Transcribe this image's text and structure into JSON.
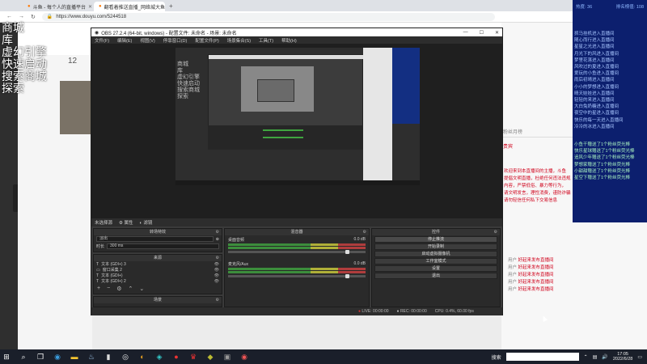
{
  "browser": {
    "tabs": [
      {
        "label": "斗鱼 - 每个人的直播平台",
        "active": false
      },
      {
        "label": "翻看着推送直播_网络城大鱼斗鱼",
        "active": true
      }
    ],
    "new_tab": "+",
    "win_min": "—",
    "win_max": "☐",
    "win_close": "✕",
    "address": "https://www.douyu.com/5244518"
  },
  "page": {
    "follow_count": "12",
    "chat_header": "粉丝月榜",
    "chat_header2": "贵宾",
    "chat_red_lines": [
      "欢迎来到本直播间的主播，斗鱼",
      "提倡文明直播，杜绝任何违法违规",
      "内容，严禁低俗、暴力等行为，",
      "请文明发言，理性消费，谨防诈骗",
      "请勿轻信任何私下交易信息"
    ],
    "chat_msgs": [
      {
        "user": "用户",
        "text": "好起来发布直播间"
      },
      {
        "user": "用户",
        "text": "好起来发布直播间"
      },
      {
        "user": "用户",
        "text": "好起来发布直播间"
      },
      {
        "user": "用户",
        "text": "好起来发布直播间"
      },
      {
        "user": "用户",
        "text": "好起来发布直播间"
      }
    ]
  },
  "overlay": {
    "text": "商城\n库\n虚幻引擎\n快速启动\n搜索商城\n探索"
  },
  "danmu": {
    "heat_label": "热度: 36",
    "rank_label": "排名榜值: 108",
    "joins": [
      "抓马挂机进入直播间",
      "随心而行进入直播间",
      "星星之光进入直播间",
      "月光下的风进入直播间",
      "梦里花落进入直播间",
      "风吹过的夏进入直播间",
      "爱玩的小鱼进入直播间",
      "雨后初晴进入直播间",
      "小小的梦想进入直播间",
      "晴天娃娃进入直播间",
      "轻轻的来进入直播间",
      "大白兔奶糖进入直播间",
      "夜空中的星进入直播间",
      "快乐的每一天进入直播间",
      "冷冷的冰进入直播间"
    ],
    "gifts": [
      "小鱼干赠送了1个粉丝荧光棒",
      "快乐星球赠送了1个粉丝荧光棒",
      "追风少年赠送了1个粉丝荧光棒",
      "梦想家赠送了1个粉丝荧光棒",
      "小甜甜赠送了1个粉丝荧光棒",
      "星空下赠送了1个粉丝荧光棒"
    ]
  },
  "obs": {
    "title": "OBS 27.2.4 (64-bit, windows) - 配置文件: 未命名 - 场景: 未命名",
    "menu": [
      "文件(F)",
      "编辑(E)",
      "视图(V)",
      "停靠窗口(D)",
      "配置文件(P)",
      "场景集合(S)",
      "工具(T)",
      "帮助(H)"
    ],
    "nested_text": "商城\n库\n虚幻引擎\n快速启动\n搜索商城\n探索",
    "scene_bar": {
      "label": "未选择源",
      "props": "属性",
      "filters": "滤镜"
    },
    "transitions": {
      "title": "转场特效",
      "type": "淡出",
      "duration_label": "时长",
      "duration_value": "300 ms"
    },
    "sources": {
      "title": "来源",
      "items": [
        {
          "icon": "T",
          "label": "文本 (GDI+) 3"
        },
        {
          "icon": "▭",
          "label": "窗口采集 2"
        },
        {
          "icon": "T",
          "label": "文本 (GDI+)"
        },
        {
          "icon": "T",
          "label": "文本 (GDI+) 2"
        }
      ]
    },
    "scenes": {
      "title": "场景",
      "item": "场景"
    },
    "mixer": {
      "title": "混音器",
      "channels": [
        {
          "name": "桌面音频",
          "vol": "0.0 dB"
        },
        {
          "name": "麦克风/Aux",
          "vol": "0.0 dB"
        }
      ]
    },
    "controls": {
      "title": "控件",
      "buttons": [
        "停止推流",
        "开始录制",
        "启动虚拟摄像机",
        "工作室模式",
        "设置",
        "退出"
      ]
    },
    "status": {
      "live": "LIVE: 00:00:00",
      "rec": "REC: 00:00:00",
      "cpu": "CPU: 0.4%, 60.00 fps"
    }
  },
  "taskbar": {
    "search_label": "搜索",
    "time": "17:05",
    "date": "2022/6/28"
  }
}
